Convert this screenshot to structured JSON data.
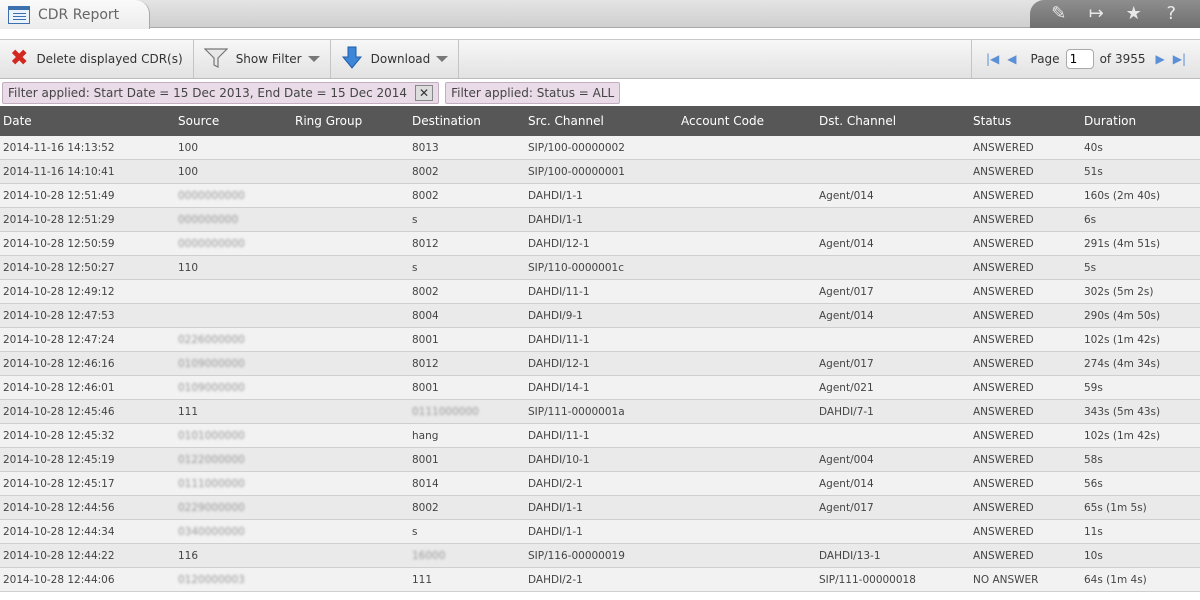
{
  "window": {
    "tab_title": "CDR Report",
    "tab_icon": "report-icon",
    "top_icons": [
      "edit-icon",
      "logout-icon",
      "star-icon",
      "help-icon"
    ]
  },
  "toolbar": {
    "delete_label": "Delete displayed CDR(s)",
    "filter_label": "Show Filter",
    "download_label": "Download",
    "page_label": "Page",
    "page_value": "1",
    "of_pages": "of 3955"
  },
  "filters": [
    "Filter applied: Start Date = 15 Dec 2013, End Date = 15 Dec 2014",
    "Filter applied: Status = ALL"
  ],
  "table": {
    "columns": [
      "Date",
      "Source",
      "Ring Group",
      "Destination",
      "Src. Channel",
      "Account Code",
      "Dst. Channel",
      "Status",
      "Duration"
    ],
    "rows": [
      [
        "2014-11-16 14:13:52",
        "100",
        "",
        "8013",
        "SIP/100-00000002",
        "",
        "",
        "ANSWERED",
        "40s"
      ],
      [
        "2014-11-16 14:10:41",
        "100",
        "",
        "8002",
        "SIP/100-00000001",
        "",
        "",
        "ANSWERED",
        "51s"
      ],
      [
        "2014-10-28 12:51:49",
        "0000000000",
        "",
        "8002",
        "DAHDI/1-1",
        "",
        "Agent/014",
        "ANSWERED",
        "160s (2m 40s)"
      ],
      [
        "2014-10-28 12:51:29",
        "000000000",
        "",
        "s",
        "DAHDI/1-1",
        "",
        "",
        "ANSWERED",
        "6s"
      ],
      [
        "2014-10-28 12:50:59",
        "0000000000",
        "",
        "8012",
        "DAHDI/12-1",
        "",
        "Agent/014",
        "ANSWERED",
        "291s (4m 51s)"
      ],
      [
        "2014-10-28 12:50:27",
        "110",
        "",
        "s",
        "SIP/110-0000001c",
        "",
        "",
        "ANSWERED",
        "5s"
      ],
      [
        "2014-10-28 12:49:12",
        "",
        "",
        "8002",
        "DAHDI/11-1",
        "",
        "Agent/017",
        "ANSWERED",
        "302s (5m 2s)"
      ],
      [
        "2014-10-28 12:47:53",
        "",
        "",
        "8004",
        "DAHDI/9-1",
        "",
        "Agent/014",
        "ANSWERED",
        "290s (4m 50s)"
      ],
      [
        "2014-10-28 12:47:24",
        "0226000000",
        "",
        "8001",
        "DAHDI/11-1",
        "",
        "",
        "ANSWERED",
        "102s (1m 42s)"
      ],
      [
        "2014-10-28 12:46:16",
        "0109000000",
        "",
        "8012",
        "DAHDI/12-1",
        "",
        "Agent/017",
        "ANSWERED",
        "274s (4m 34s)"
      ],
      [
        "2014-10-28 12:46:01",
        "0109000000",
        "",
        "8001",
        "DAHDI/14-1",
        "",
        "Agent/021",
        "ANSWERED",
        "59s"
      ],
      [
        "2014-10-28 12:45:46",
        "111",
        "",
        "0111000000",
        "SIP/111-0000001a",
        "",
        "DAHDI/7-1",
        "ANSWERED",
        "343s (5m 43s)"
      ],
      [
        "2014-10-28 12:45:32",
        "0101000000",
        "",
        "hang",
        "DAHDI/11-1",
        "",
        "",
        "ANSWERED",
        "102s (1m 42s)"
      ],
      [
        "2014-10-28 12:45:19",
        "0122000000",
        "",
        "8001",
        "DAHDI/10-1",
        "",
        "Agent/004",
        "ANSWERED",
        "58s"
      ],
      [
        "2014-10-28 12:45:17",
        "0111000000",
        "",
        "8014",
        "DAHDI/2-1",
        "",
        "Agent/014",
        "ANSWERED",
        "56s"
      ],
      [
        "2014-10-28 12:44:56",
        "0229000000",
        "",
        "8002",
        "DAHDI/1-1",
        "",
        "Agent/017",
        "ANSWERED",
        "65s (1m 5s)"
      ],
      [
        "2014-10-28 12:44:34",
        "0340000000",
        "",
        "s",
        "DAHDI/1-1",
        "",
        "",
        "ANSWERED",
        "11s"
      ],
      [
        "2014-10-28 12:44:22",
        "116",
        "",
        "16000",
        "SIP/116-00000019",
        "",
        "DAHDI/13-1",
        "ANSWERED",
        "10s"
      ],
      [
        "2014-10-28 12:44:06",
        "0120000003",
        "",
        "111",
        "DAHDI/2-1",
        "",
        "SIP/111-00000018",
        "NO ANSWER",
        "64s (1m 4s)"
      ]
    ]
  }
}
